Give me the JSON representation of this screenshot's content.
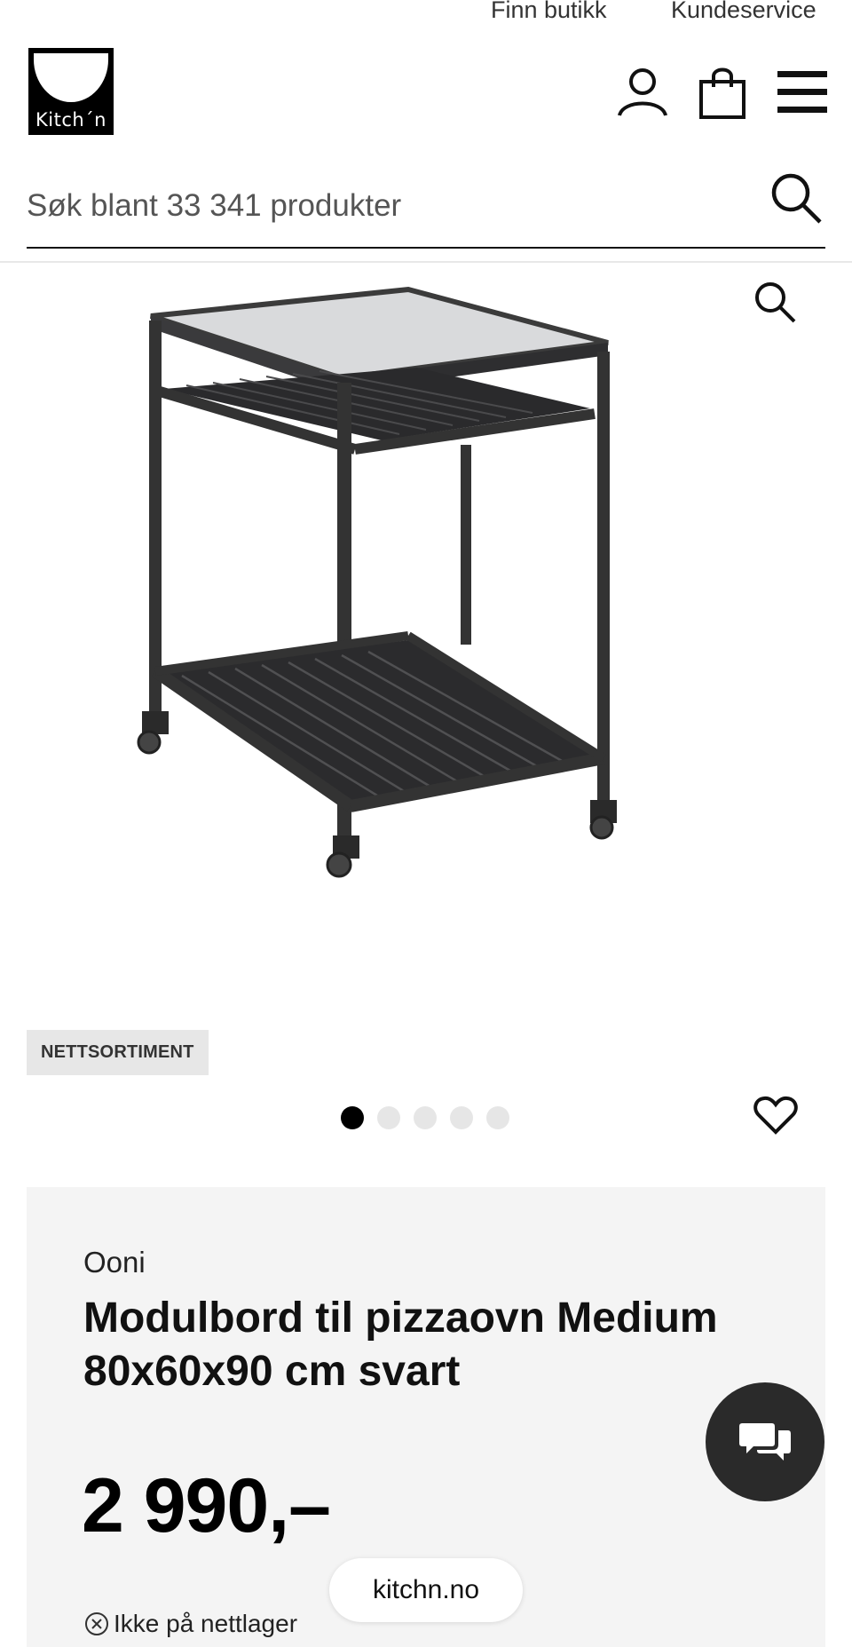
{
  "topbar": {
    "store_link": "Finn butikk",
    "service_link": "Kundeservice"
  },
  "header": {
    "logo_text": "Kitch´n",
    "icons": [
      "user-icon",
      "shopping-bag-icon",
      "hamburger-menu-icon"
    ]
  },
  "search": {
    "placeholder": "Søk blant 33 341 produkter",
    "icon": "search-icon"
  },
  "gallery": {
    "badge": "NETTSORTIMENT",
    "image_count": 5,
    "active_index": 0,
    "icons": [
      "zoom-icon",
      "heart-icon"
    ]
  },
  "product": {
    "brand": "Ooni",
    "title": "Modulbord til pizzaovn Medium 80x60x90 cm svart",
    "price": "2 990,–",
    "stock_status": "Ikke på nettlager",
    "stock_icon": "x-circle-icon"
  },
  "chat": {
    "icon": "chat-bubbles-icon"
  },
  "browser": {
    "url": "kitchn.no"
  },
  "colors": {
    "text": "#111111",
    "badge_bg": "#e7e7e7",
    "info_bg": "#f4f4f4",
    "chat_bg": "#2a2a2a",
    "dot_active": "#000000",
    "dot_inactive": "#e6e6e6"
  }
}
